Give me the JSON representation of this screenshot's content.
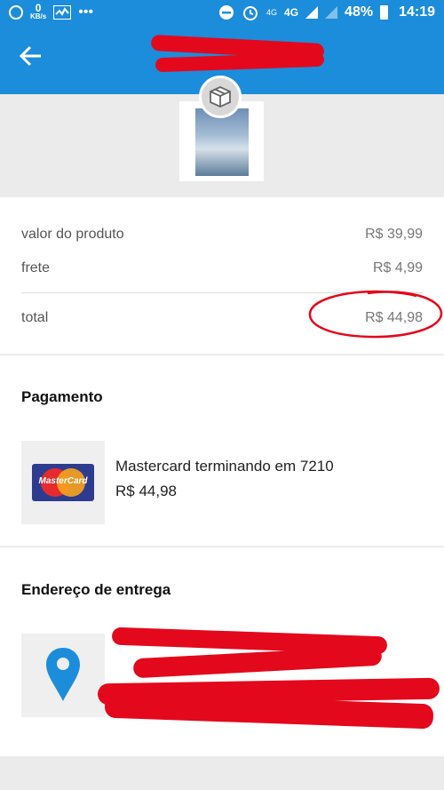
{
  "status_bar": {
    "net_speed_value": "0",
    "net_speed_unit": "KB/s",
    "network_1": "4G",
    "network_2": "4G",
    "battery": "48%",
    "time": "14:19"
  },
  "header": {
    "back_icon": "arrow-left-icon"
  },
  "summary": {
    "product_label": "valor do produto",
    "product_value": "R$ 39,99",
    "shipping_label": "frete",
    "shipping_value": "R$ 4,99",
    "total_label": "total",
    "total_value": "R$ 44,98"
  },
  "payment": {
    "title": "Pagamento",
    "card_brand_logo_text": "MasterCard",
    "method": "Mastercard terminando em 7210",
    "amount": "R$ 44,98"
  },
  "address": {
    "title": "Endereço de entrega",
    "icon": "location-pin-icon"
  },
  "colors": {
    "accent": "#1c8ddb",
    "annotation_red": "#e4081c"
  }
}
